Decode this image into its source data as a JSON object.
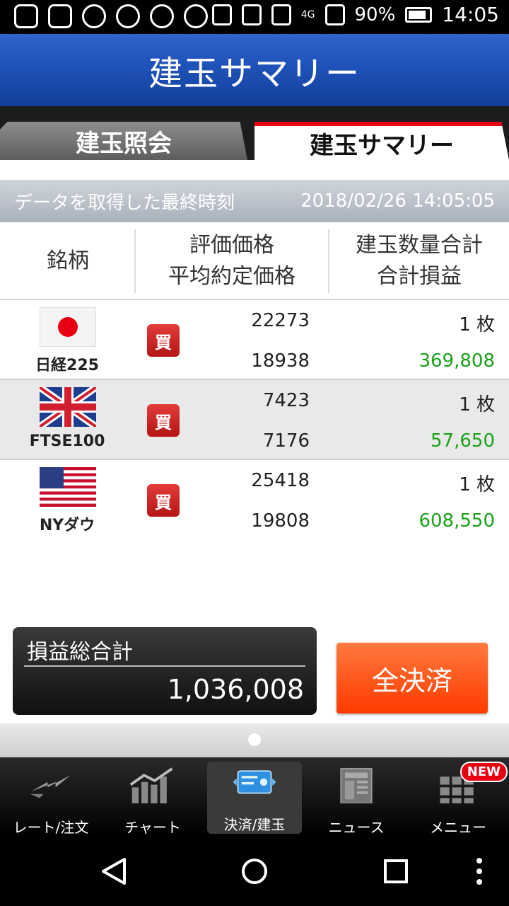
{
  "status_bar": {
    "battery": "90%",
    "time": "14:05",
    "network": "4G"
  },
  "title": "建玉サマリー",
  "tabs": [
    {
      "label": "建玉照会",
      "active": false
    },
    {
      "label": "建玉サマリー",
      "active": true
    }
  ],
  "info": {
    "label": "データを取得した最終時刻",
    "timestamp": "2018/02/26 14:05:05"
  },
  "headers": {
    "symbol": "銘柄",
    "price_line1": "評価価格",
    "price_line2": "平均約定価格",
    "qty_line1": "建玉数量合計",
    "qty_line2": "合計損益"
  },
  "rows": [
    {
      "symbol": "日経225",
      "flag": "japan-flag-icon",
      "side": "買",
      "eval_price": "22273",
      "avg_price": "18938",
      "qty": "1 枚",
      "pl": "369,808"
    },
    {
      "symbol": "FTSE100",
      "flag": "uk-flag-icon",
      "side": "買",
      "eval_price": "7423",
      "avg_price": "7176",
      "qty": "1 枚",
      "pl": "57,650"
    },
    {
      "symbol": "NYダウ",
      "flag": "us-flag-icon",
      "side": "買",
      "eval_price": "25418",
      "avg_price": "19808",
      "qty": "1 枚",
      "pl": "608,550"
    }
  ],
  "total": {
    "label": "損益総合計",
    "value": "1,036,008"
  },
  "close_all_button": "全決済",
  "bottom_nav": [
    {
      "label": "レート/注文",
      "icon": "rate-order-icon"
    },
    {
      "label": "チャート",
      "icon": "chart-icon"
    },
    {
      "label": "決済/建玉",
      "icon": "settlement-icon",
      "selected": true
    },
    {
      "label": "ニュース",
      "icon": "news-icon"
    },
    {
      "label": "メニュー",
      "icon": "menu-grid-icon",
      "badge": "NEW"
    }
  ],
  "colors": {
    "accent_red": "#e60012",
    "profit_green": "#1aa31a",
    "title_blue": "#1f52b8",
    "button_orange": "#ff4a10"
  }
}
